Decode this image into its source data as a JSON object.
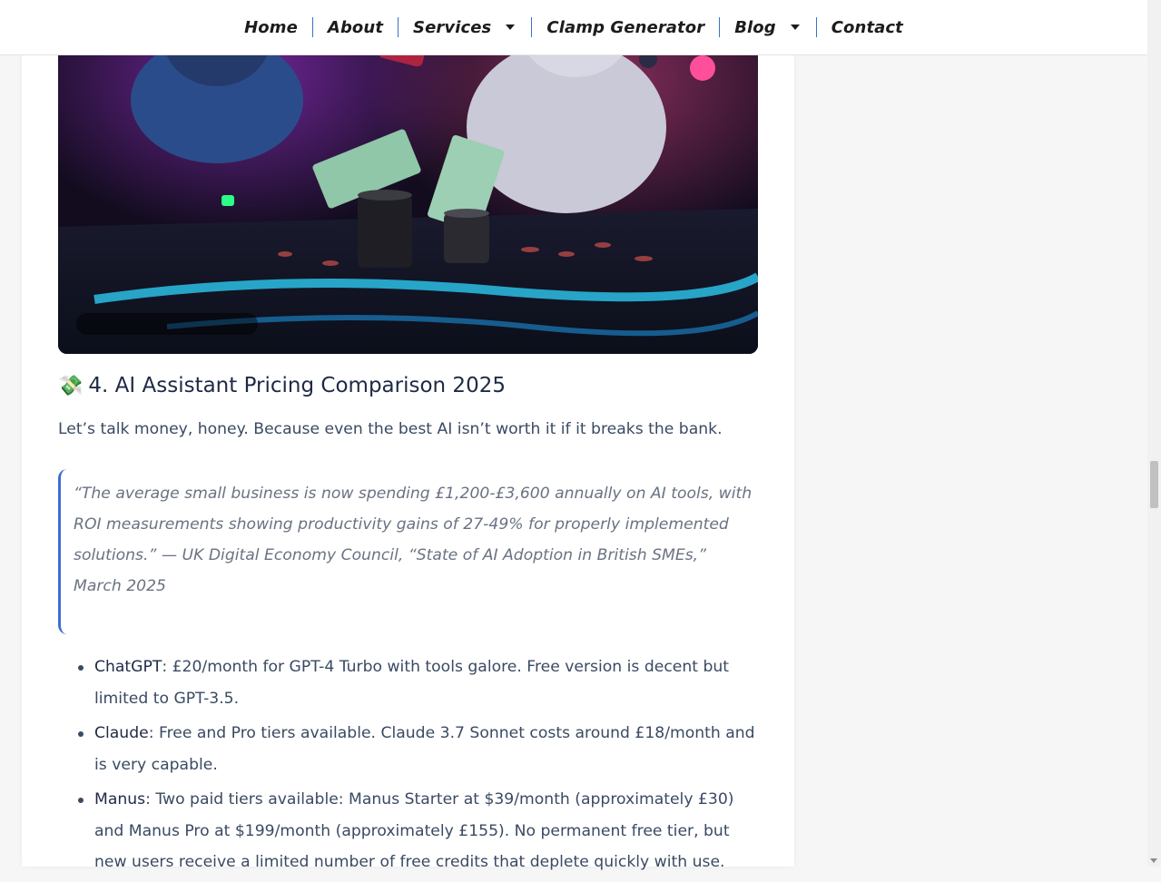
{
  "nav": {
    "items": [
      {
        "label": "Home",
        "has_dropdown": false
      },
      {
        "label": "About",
        "has_dropdown": false
      },
      {
        "label": "Services",
        "has_dropdown": true
      },
      {
        "label": "Clamp Generator",
        "has_dropdown": false
      },
      {
        "label": "Blog",
        "has_dropdown": true
      },
      {
        "label": "Contact",
        "has_dropdown": false
      }
    ]
  },
  "article": {
    "hero_image_alt": "",
    "section_heading": {
      "emoji": "💸",
      "text": "4. AI Assistant Pricing Comparison 2025"
    },
    "intro": "Let’s talk money, honey. Because even the best AI isn’t worth it if it breaks the bank.",
    "quote": "“The average small business is now spending £1,200-£3,600 annually on AI tools, with ROI measurements showing productivity gains of 27-49% for properly implemented solutions.” — UK Digital Economy Council, “State of AI Adoption in British SMEs,” March 2025",
    "list": [
      {
        "term": "ChatGPT",
        "text": ": £20/month for GPT-4 Turbo with tools galore. Free version is decent but limited to GPT-3.5."
      },
      {
        "term": "Claude",
        "text": ": Free and Pro tiers available. Claude 3.7 Sonnet costs around £18/month and is very capable."
      },
      {
        "term": "Manus",
        "text": ": Two paid tiers available: Manus Starter at $39/month (approximately £30) and Manus Pro at $199/month (approximately £155). No permanent free tier, but new users receive a limited number of free credits that deplete quickly with use."
      }
    ]
  },
  "colors": {
    "accent": "#3b6fd0",
    "heading": "#1e2a45",
    "body_text": "#3a4a63",
    "quote_text": "#6a7282"
  }
}
